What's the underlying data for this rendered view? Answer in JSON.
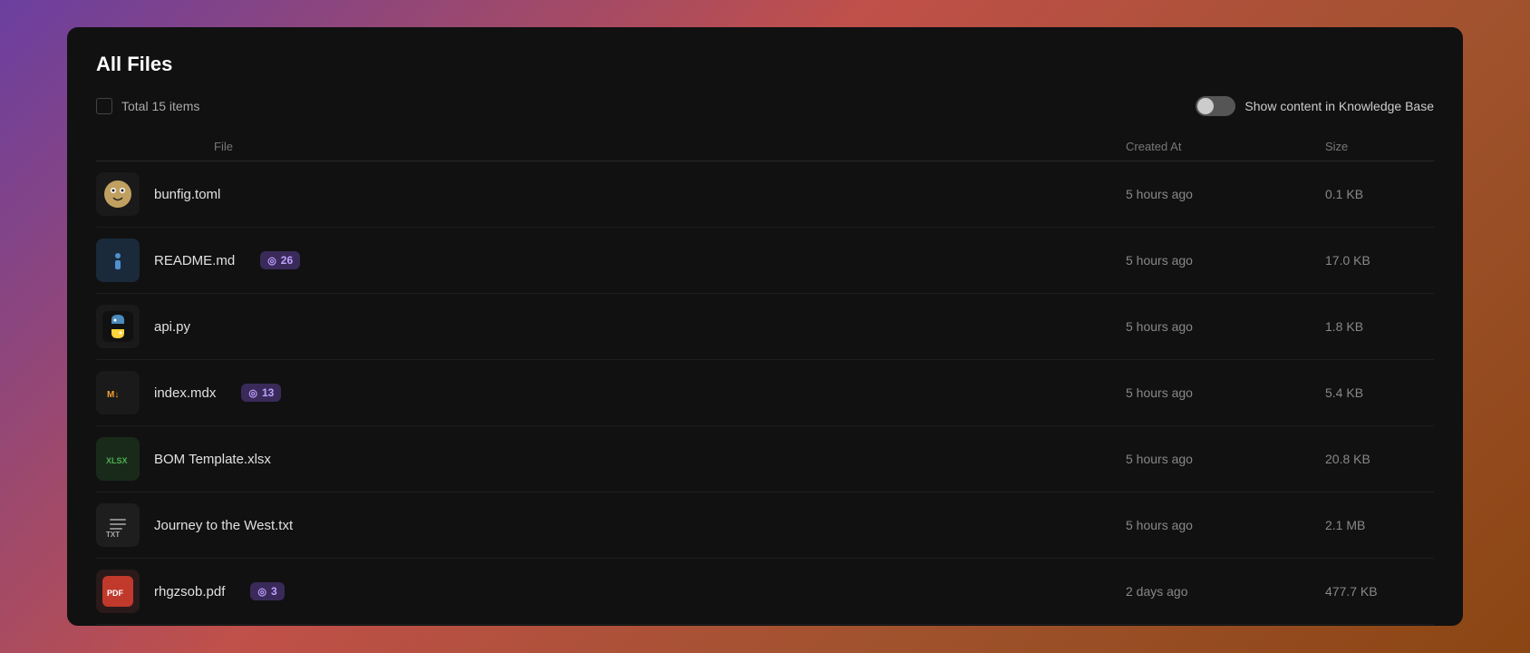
{
  "panel": {
    "title": "All Files",
    "total_label": "Total 15 items"
  },
  "toolbar": {
    "toggle_label": "Show content in Knowledge Base"
  },
  "table": {
    "headers": {
      "file": "File",
      "created_at": "Created At",
      "size": "Size"
    },
    "rows": [
      {
        "id": 1,
        "name": "bunfig.toml",
        "icon_type": "bun",
        "icon_label": "🐰",
        "badge": null,
        "created_at": "5 hours ago",
        "size": "0.1 KB"
      },
      {
        "id": 2,
        "name": "README.md",
        "icon_type": "info",
        "icon_label": "ℹ",
        "badge": "26",
        "created_at": "5 hours ago",
        "size": "17.0 KB"
      },
      {
        "id": 3,
        "name": "api.py",
        "icon_type": "python",
        "icon_label": "🐍",
        "badge": null,
        "created_at": "5 hours ago",
        "size": "1.8 KB"
      },
      {
        "id": 4,
        "name": "index.mdx",
        "icon_type": "mdx",
        "icon_label": "↓",
        "badge": "13",
        "created_at": "5 hours ago",
        "size": "5.4 KB"
      },
      {
        "id": 5,
        "name": "BOM Template.xlsx",
        "icon_type": "xlsx",
        "icon_label": "XLSX",
        "badge": null,
        "created_at": "5 hours ago",
        "size": "20.8 KB"
      },
      {
        "id": 6,
        "name": "Journey to the West.txt",
        "icon_type": "txt",
        "icon_label": "TXT",
        "badge": null,
        "created_at": "5 hours ago",
        "size": "2.1 MB"
      },
      {
        "id": 7,
        "name": "rhgzsob.pdf",
        "icon_type": "pdf",
        "icon_label": "PDF",
        "badge": "3",
        "created_at": "2 days ago",
        "size": "477.7 KB"
      }
    ]
  }
}
